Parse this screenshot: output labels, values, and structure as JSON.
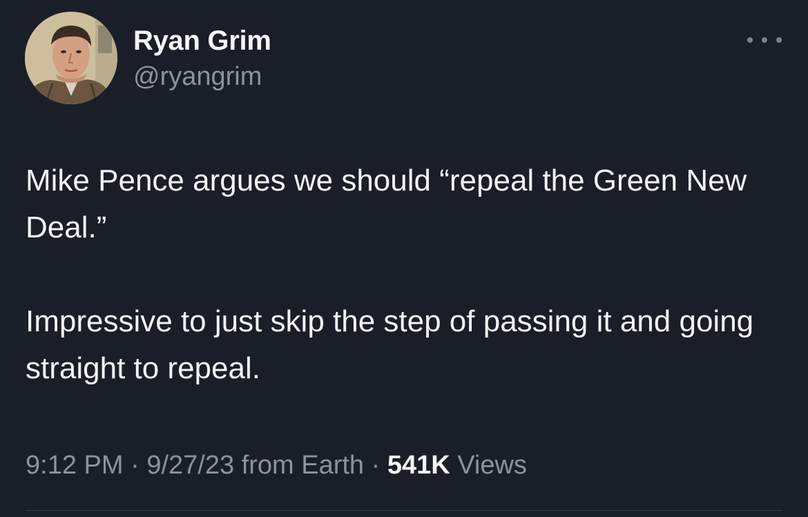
{
  "author": {
    "display_name": "Ryan Grim",
    "handle": "@ryangrim",
    "avatar_icon": "profile-portrait"
  },
  "tweet": {
    "paragraph_1": "Mike Pence argues we should “repeal the Green New Deal.”",
    "paragraph_2": "Impressive to just skip the step of passing it and going straight to repeal."
  },
  "meta": {
    "time": "9:12 PM",
    "separator": " · ",
    "date": "9/27/23",
    "source": " from Earth",
    "views_count": "541K",
    "views_label": " Views"
  },
  "icons": {
    "more": "more-options-icon"
  },
  "colors": {
    "background": "#1a1e29",
    "text_primary": "#f3f4f6",
    "text_secondary": "#8b93a0"
  }
}
